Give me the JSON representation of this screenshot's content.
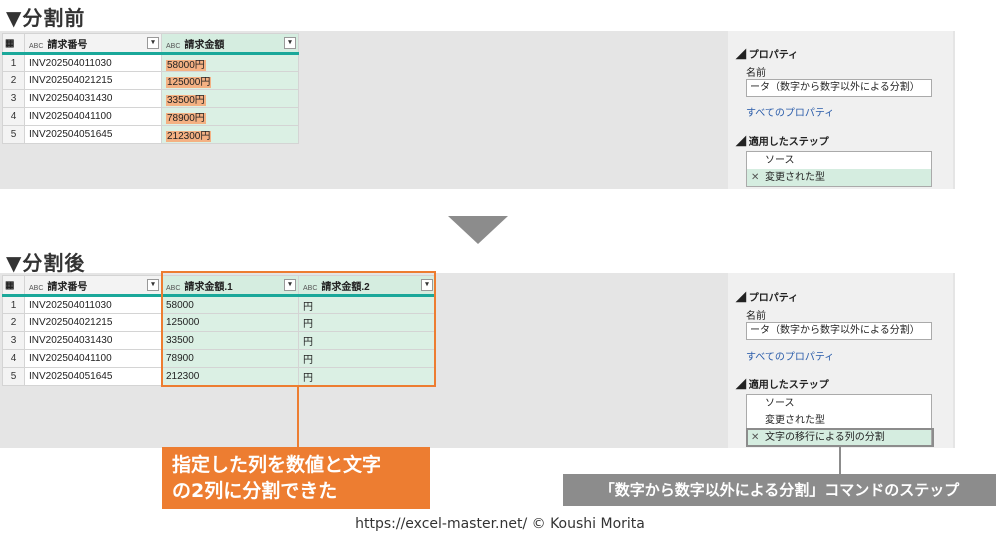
{
  "before": {
    "heading": "▼分割前",
    "columns": [
      "請求番号",
      "請求金額"
    ],
    "rows": [
      {
        "num": "1",
        "id": "INV202504011030",
        "amount": "58000円"
      },
      {
        "num": "2",
        "id": "INV202504021215",
        "amount": "125000円"
      },
      {
        "num": "3",
        "id": "INV202504031430",
        "amount": "33500円"
      },
      {
        "num": "4",
        "id": "INV202504041100",
        "amount": "78900円"
      },
      {
        "num": "5",
        "id": "INV202504051645",
        "amount": "212300円"
      }
    ]
  },
  "after": {
    "heading": "▼分割後",
    "columns": [
      "請求番号",
      "請求金額.1",
      "請求金額.2"
    ],
    "rows": [
      {
        "num": "1",
        "id": "INV202504011030",
        "amount1": "58000",
        "amount2": "円"
      },
      {
        "num": "2",
        "id": "INV202504021215",
        "amount1": "125000",
        "amount2": "円"
      },
      {
        "num": "3",
        "id": "INV202504031430",
        "amount1": "33500",
        "amount2": "円"
      },
      {
        "num": "4",
        "id": "INV202504041100",
        "amount1": "78900",
        "amount2": "円"
      },
      {
        "num": "5",
        "id": "INV202504051645",
        "amount1": "212300",
        "amount2": "円"
      }
    ]
  },
  "properties": {
    "section_title": "プロパティ",
    "name_label": "名前",
    "name_value": "ータ（数字から数字以外による分割）",
    "all_props_link": "すべてのプロパティ",
    "steps_title": "適用したステップ"
  },
  "steps_before": [
    "ソース",
    "変更された型"
  ],
  "steps_after": [
    "ソース",
    "変更された型",
    "文字の移行による列の分割"
  ],
  "type_icon_text": "ABC",
  "callouts": {
    "orange_line1": "指定した列を数値と文字",
    "orange_line2": "の2列に分割できた",
    "gray": "「数字から数字以外による分割」コマンドのステップ"
  },
  "footer": "https://excel-master.net/  © Koushi Morita",
  "colors": {
    "accent_orange": "#ed7d31",
    "selected_green": "#d5ede0",
    "header_teal": "#1aa89a",
    "gray": "#8c8c8c"
  }
}
